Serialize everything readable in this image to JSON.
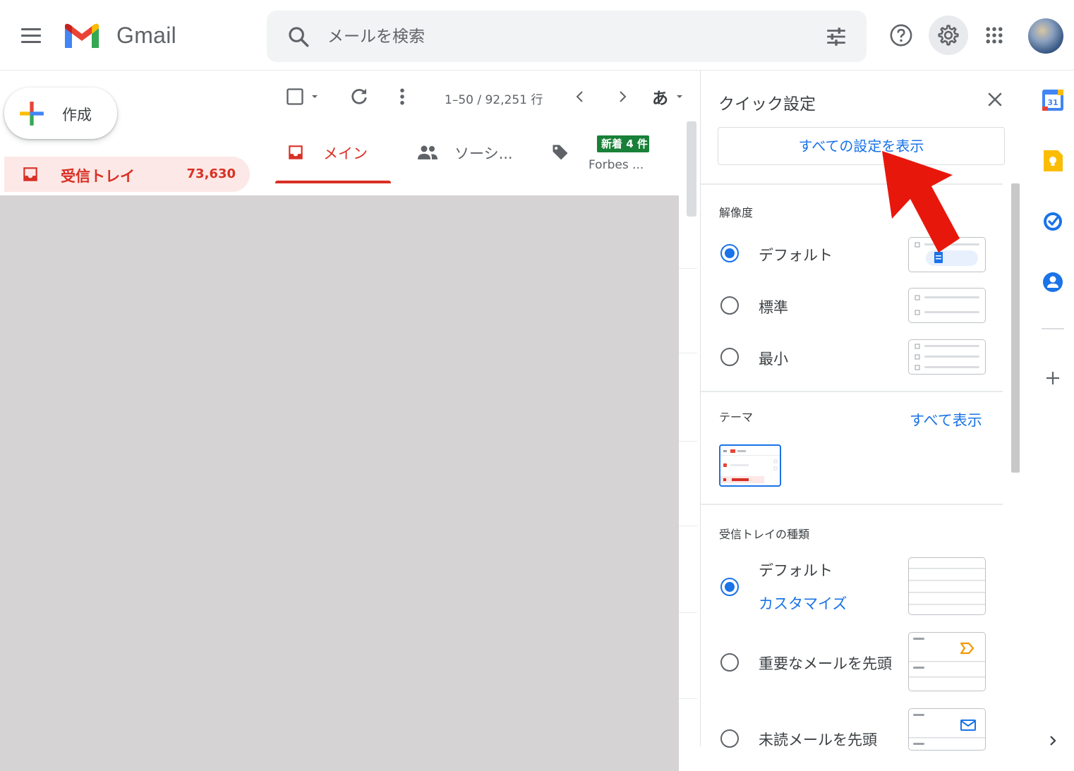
{
  "header": {
    "app_name": "Gmail",
    "search_placeholder": "メールを検索"
  },
  "sidebar": {
    "compose_label": "作成",
    "inbox_label": "受信トレイ",
    "inbox_count": "73,630"
  },
  "list": {
    "range": "1–50 / 92,251 行",
    "input_tool_label": "あ",
    "tabs": [
      {
        "label": "メイン"
      },
      {
        "label": "ソーシ..."
      },
      {
        "label": "新着 4 件",
        "sub": "Forbes ..."
      }
    ]
  },
  "quick_settings": {
    "title": "クイック設定",
    "all_settings": "すべての設定を表示",
    "density_heading": "解像度",
    "density_options": [
      "デフォルト",
      "標準",
      "最小"
    ],
    "density_selected": "デフォルト",
    "theme_heading": "テーマ",
    "theme_view_all": "すべて表示",
    "inbox_type_heading": "受信トレイの種類",
    "inbox_types": [
      "デフォルト",
      "重要なメールを先頭",
      "未読メールを先頭"
    ],
    "inbox_type_selected": "デフォルト",
    "customize": "カスタマイズ"
  },
  "rail": {
    "calendar_day": "31"
  },
  "colors": {
    "accent_red": "#d93025",
    "link_blue": "#1a73e8",
    "badge_green": "#188038",
    "arrow_red": "#e8170c"
  }
}
